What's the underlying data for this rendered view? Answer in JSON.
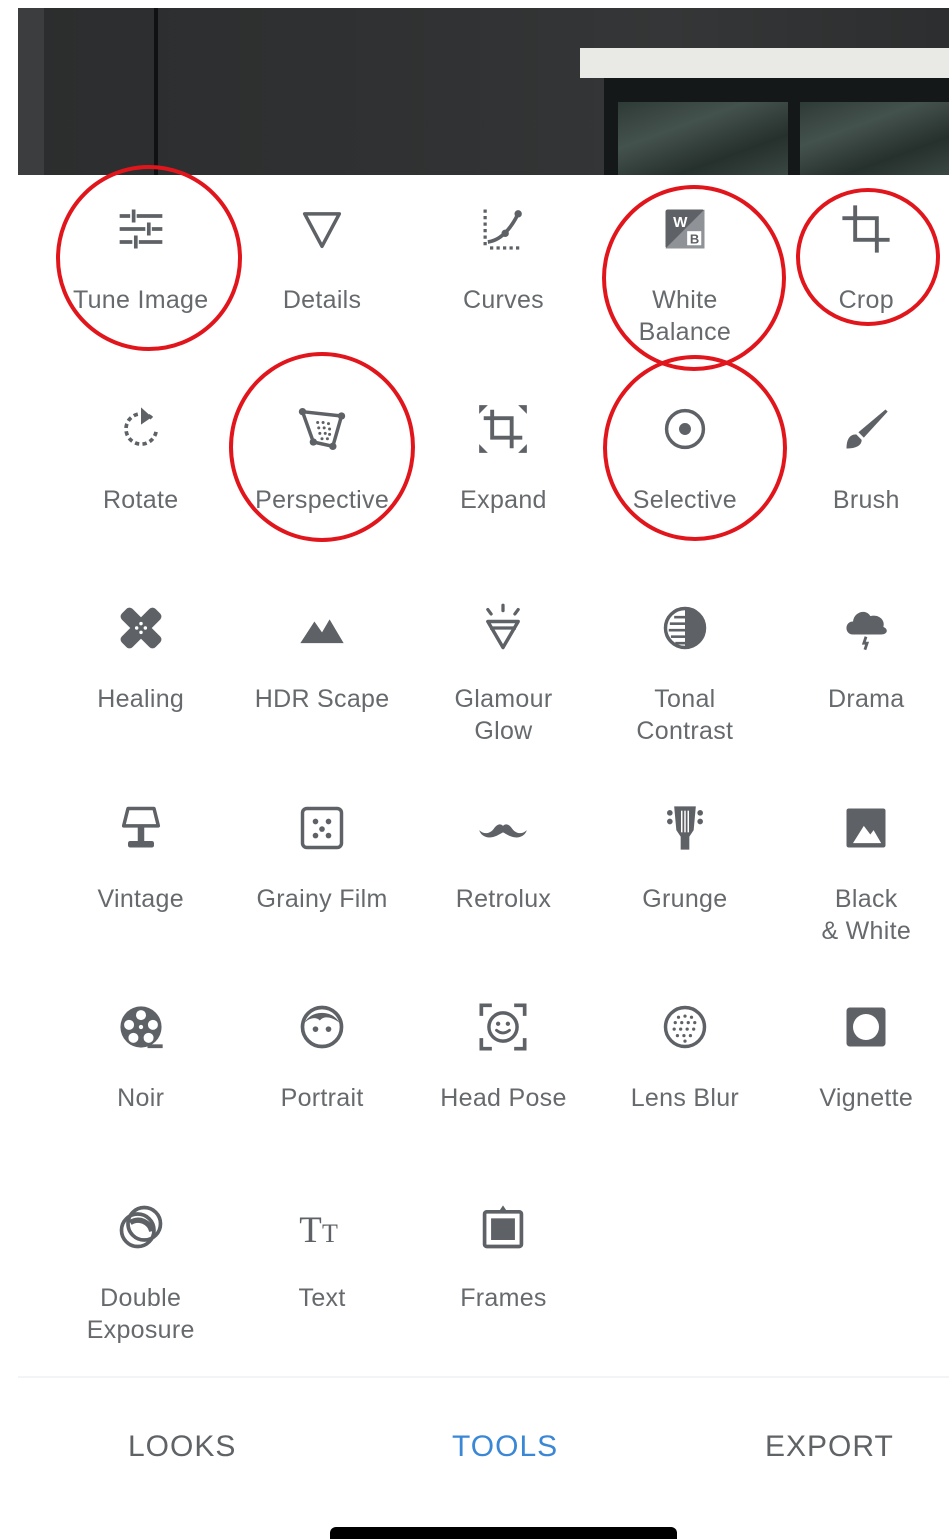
{
  "tools": [
    {
      "label": "Tune Image",
      "icon": "tune-sliders-icon",
      "key": "tune-image"
    },
    {
      "label": "Details",
      "icon": "triangle-down-icon",
      "key": "details"
    },
    {
      "label": "Curves",
      "icon": "curves-icon",
      "key": "curves"
    },
    {
      "label": "White\nBalance",
      "icon": "white-balance-icon",
      "key": "white-balance"
    },
    {
      "label": "Crop",
      "icon": "crop-icon",
      "key": "crop"
    },
    {
      "label": "Rotate",
      "icon": "rotate-icon",
      "key": "rotate"
    },
    {
      "label": "Perspective",
      "icon": "perspective-icon",
      "key": "perspective"
    },
    {
      "label": "Expand",
      "icon": "expand-icon",
      "key": "expand"
    },
    {
      "label": "Selective",
      "icon": "target-icon",
      "key": "selective"
    },
    {
      "label": "Brush",
      "icon": "brush-icon",
      "key": "brush"
    },
    {
      "label": "Healing",
      "icon": "bandage-icon",
      "key": "healing"
    },
    {
      "label": "HDR Scape",
      "icon": "mountains-icon",
      "key": "hdr-scape"
    },
    {
      "label": "Glamour\nGlow",
      "icon": "diamond-icon",
      "key": "glamour-glow"
    },
    {
      "label": "Tonal\nContrast",
      "icon": "contrast-icon",
      "key": "tonal-contrast"
    },
    {
      "label": "Drama",
      "icon": "storm-cloud-icon",
      "key": "drama"
    },
    {
      "label": "Vintage",
      "icon": "lamp-icon",
      "key": "vintage"
    },
    {
      "label": "Grainy Film",
      "icon": "film-grain-icon",
      "key": "grainy-film"
    },
    {
      "label": "Retrolux",
      "icon": "mustache-icon",
      "key": "retrolux"
    },
    {
      "label": "Grunge",
      "icon": "guitar-head-icon",
      "key": "grunge"
    },
    {
      "label": "Black\n& White",
      "icon": "black-white-icon",
      "key": "black-white"
    },
    {
      "label": "Noir",
      "icon": "film-reel-icon",
      "key": "noir"
    },
    {
      "label": "Portrait",
      "icon": "face-icon",
      "key": "portrait"
    },
    {
      "label": "Head Pose",
      "icon": "face-frame-icon",
      "key": "head-pose"
    },
    {
      "label": "Lens Blur",
      "icon": "lens-blur-icon",
      "key": "lens-blur"
    },
    {
      "label": "Vignette",
      "icon": "vignette-icon",
      "key": "vignette"
    },
    {
      "label": "Double\nExposure",
      "icon": "double-circle-icon",
      "key": "double-exposure"
    },
    {
      "label": "Text",
      "icon": "text-icon",
      "key": "text"
    },
    {
      "label": "Frames",
      "icon": "frame-icon",
      "key": "frames"
    }
  ],
  "highlighted_tools": [
    "tune-image",
    "white-balance",
    "crop",
    "perspective",
    "selective"
  ],
  "bottom_nav": {
    "looks": "LOOKS",
    "tools": "TOOLS",
    "export": "EXPORT",
    "active": "tools"
  },
  "colors": {
    "icon": "#5e6266",
    "label": "#666a6d",
    "accent": "#3a87d6",
    "annotation": "#e1161c"
  }
}
